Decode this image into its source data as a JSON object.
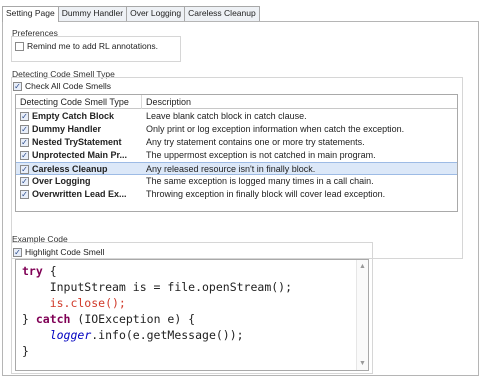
{
  "tabs": [
    "Setting Page",
    "Dummy Handler",
    "Over Logging",
    "Careless Cleanup"
  ],
  "preferences": {
    "label": "Preferences",
    "remind_label": "Remind me to add RL annotations."
  },
  "detecting": {
    "label": "Detecting Code Smell Type",
    "check_all_label": "Check All Code Smells",
    "columns": [
      "Detecting Code Smell Type",
      "Description"
    ],
    "rows": [
      {
        "name": "Empty Catch Block",
        "desc": "Leave blank catch block in catch clause."
      },
      {
        "name": "Dummy Handler",
        "desc": "Only print or log exception information when catch the exception."
      },
      {
        "name": "Nested TryStatement",
        "desc": "Any try statement contains one or more try statements."
      },
      {
        "name": "Unprotected Main Pr...",
        "desc": "The uppermost exception is not catched in main program."
      },
      {
        "name": "Careless Cleanup",
        "desc": "Any released resource isn't in finally block."
      },
      {
        "name": "Over Logging",
        "desc": "The same exception is logged many times in a call chain."
      },
      {
        "name": "Overwritten Lead Ex...",
        "desc": "Throwing exception in finally block will cover lead exception."
      }
    ],
    "selected_index": 4
  },
  "example": {
    "label": "Example Code",
    "highlight_label": "Highlight Code Smell",
    "code": {
      "l1_kw": "try",
      "l1_rest": " {",
      "l2": "    InputStream is = file.openStream();",
      "l3": "    is.close();",
      "l4_a": "} ",
      "l4_kw": "catch",
      "l4_b": " (IOException e) {",
      "l5_a": "    ",
      "l5_it": "logger",
      "l5_b": ".info(e.getMessage());",
      "l6": "}"
    }
  },
  "colors": {
    "accent": "#7f0055",
    "highlight": "#d03a2a",
    "selection": "#dce8f8"
  },
  "icons": [
    "checkbox-checked-icon",
    "checkbox-unchecked-icon",
    "scroll-up-icon",
    "scroll-down-icon"
  ]
}
